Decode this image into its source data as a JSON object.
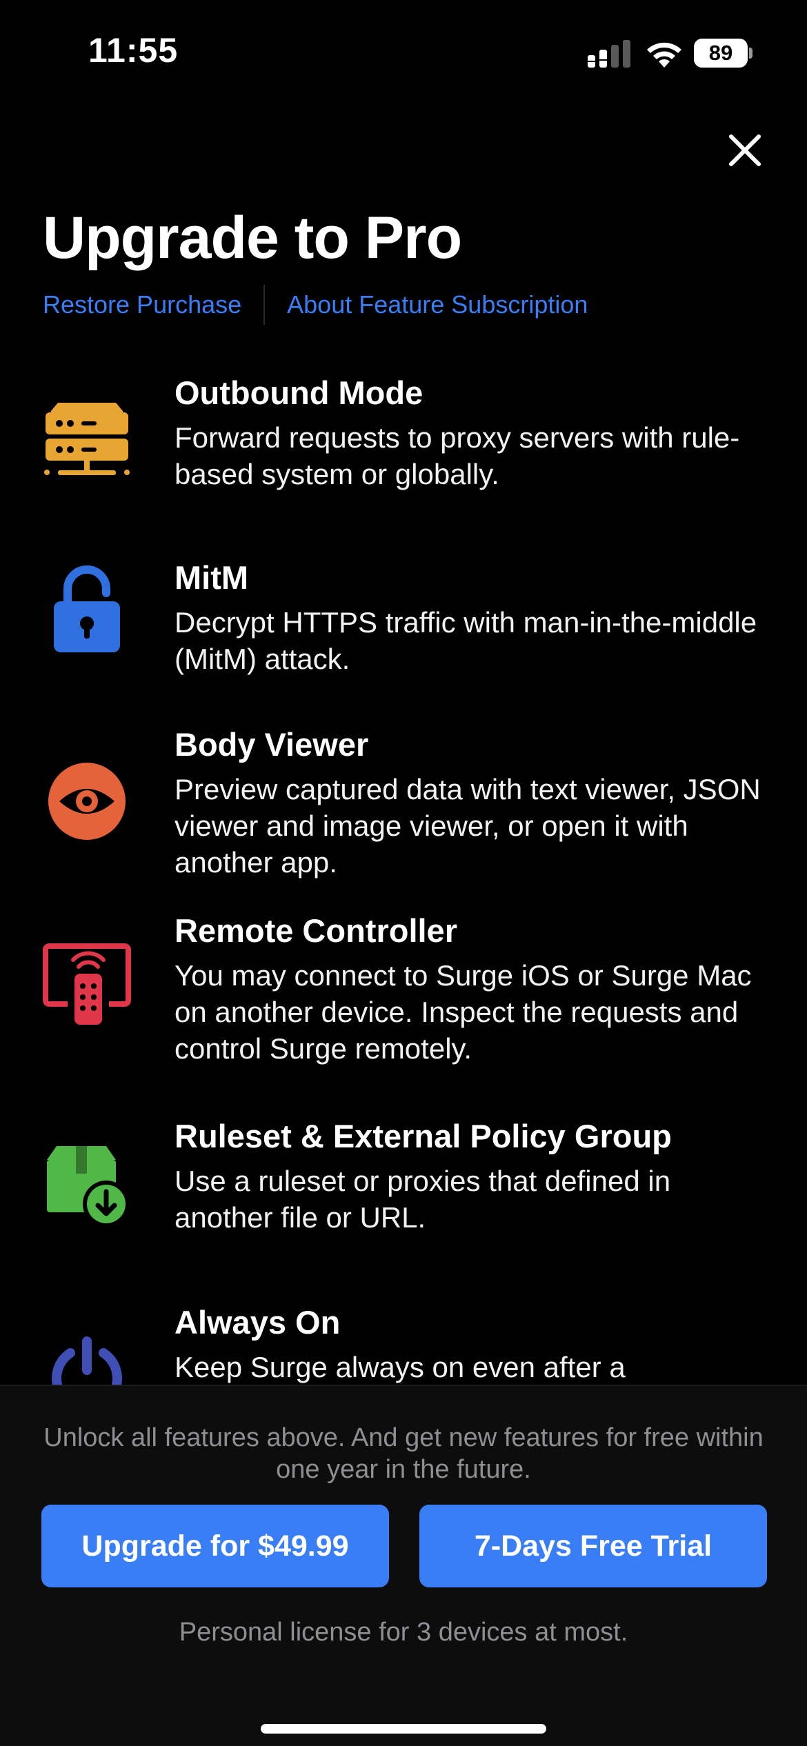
{
  "status_bar": {
    "time": "11:55",
    "battery": "89",
    "icons": [
      "cellular-signal-icon",
      "wifi-icon",
      "battery-icon"
    ]
  },
  "close_icon": "close-icon",
  "header": {
    "title": "Upgrade to Pro",
    "restore_link": "Restore Purchase",
    "about_link": "About Feature Subscription"
  },
  "features": [
    {
      "title": "Outbound Mode",
      "desc": "Forward requests to proxy servers with rule-based system or globally.",
      "icon": "server-icon",
      "color": "#E8A531"
    },
    {
      "title": "MitM",
      "desc": "Decrypt HTTPS traffic with man-in-the-middle (MitM) attack.",
      "icon": "unlock-icon",
      "color": "#2F6FE0"
    },
    {
      "title": "Body Viewer",
      "desc": "Preview captured data with text viewer, JSON viewer and image viewer, or open it with another app.",
      "icon": "eye-icon",
      "color": "#E5633A"
    },
    {
      "title": "Remote Controller",
      "desc": "You may connect to Surge iOS or Surge Mac on another device. Inspect the requests and control Surge remotely.",
      "icon": "remote-icon",
      "color": "#E0364A"
    },
    {
      "title": "Ruleset & External Policy Group",
      "desc": "Use a ruleset or proxies that defined in another file or URL.",
      "icon": "package-download-icon",
      "color": "#4FB846"
    },
    {
      "title": "Always On",
      "desc": "Keep Surge always on even after a",
      "icon": "power-icon",
      "color": "#3F4FB5"
    }
  ],
  "footer": {
    "unlock_note": "Unlock all features above. And get new features for free within one year in the future.",
    "upgrade_button": "Upgrade for $49.99",
    "trial_button": "7-Days Free Trial",
    "license_note": "Personal license for 3 devices at most."
  },
  "colors": {
    "accent": "#3A7EF5",
    "background": "#000000",
    "muted_text": "#8E8E93"
  }
}
